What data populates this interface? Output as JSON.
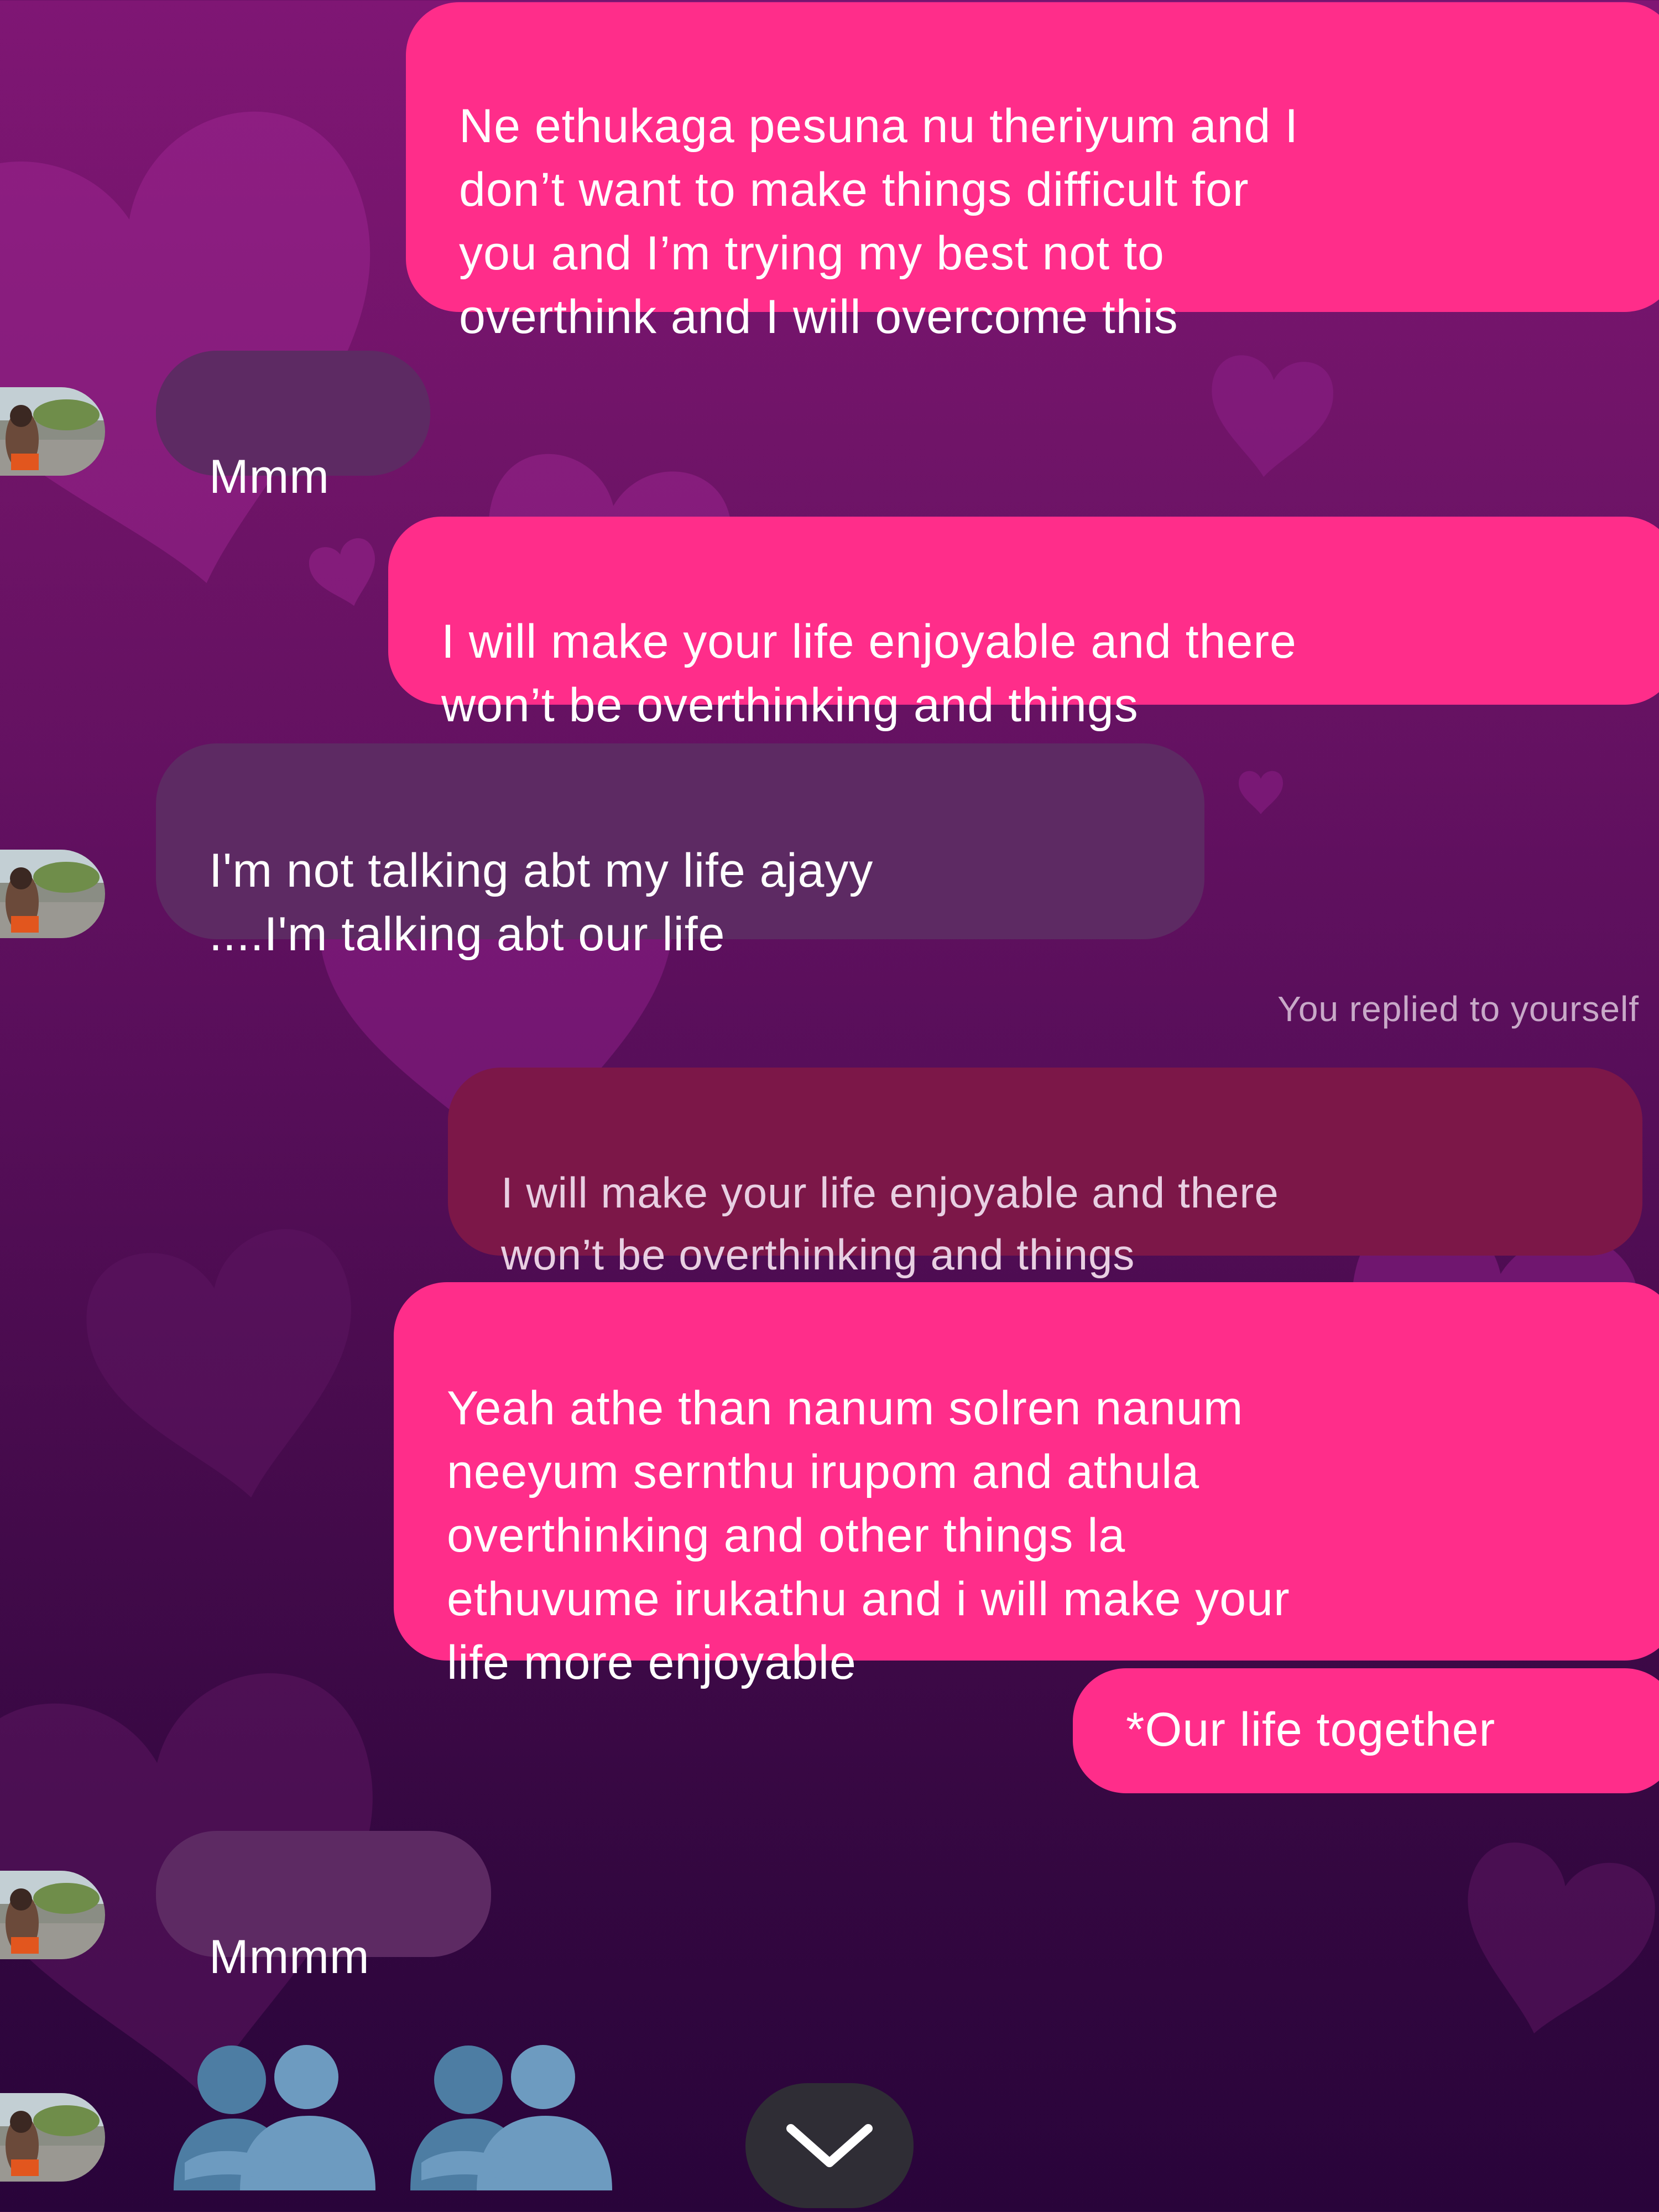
{
  "conversation": {
    "messages": [
      {
        "direction": "outgoing",
        "text": "Ne ethukaga pesuna nu theriyum and I\ndon’t want to make things difficult for\nyou and I’m trying my best not to\noverthink and I will overcome this"
      },
      {
        "direction": "incoming",
        "text": "Mmm"
      },
      {
        "direction": "outgoing",
        "text": "I will make your life enjoyable and there\nwon’t be overthinking and things"
      },
      {
        "direction": "incoming",
        "text": "I'm not talking abt my life ajayy\n....I'm talking abt our life"
      },
      {
        "direction": "outgoing",
        "reply_note": "You replied to yourself",
        "quoted_text": "I will make your life enjoyable and there\nwon’t be overthinking and things",
        "text": "Yeah athe than nanum solren nanum\nneeyum sernthu irupom and athula\noverthinking and other things la\nethuvume irukathu and i will make your\nlife more enjoyable"
      },
      {
        "direction": "outgoing",
        "text": "*Our life together"
      },
      {
        "direction": "incoming",
        "text": "Mmmm"
      },
      {
        "direction": "incoming",
        "emoji": [
          "people-hugging",
          "people-hugging"
        ]
      }
    ]
  },
  "colors": {
    "outgoing_bubble": "#ff2d8a",
    "incoming_bubble": "#5d2a63",
    "quoted_bubble": "#7c1748",
    "background_top": "#7f1674",
    "background_bottom": "#29043a"
  },
  "controls": {
    "scroll_down_icon": "chevron-down-icon"
  }
}
